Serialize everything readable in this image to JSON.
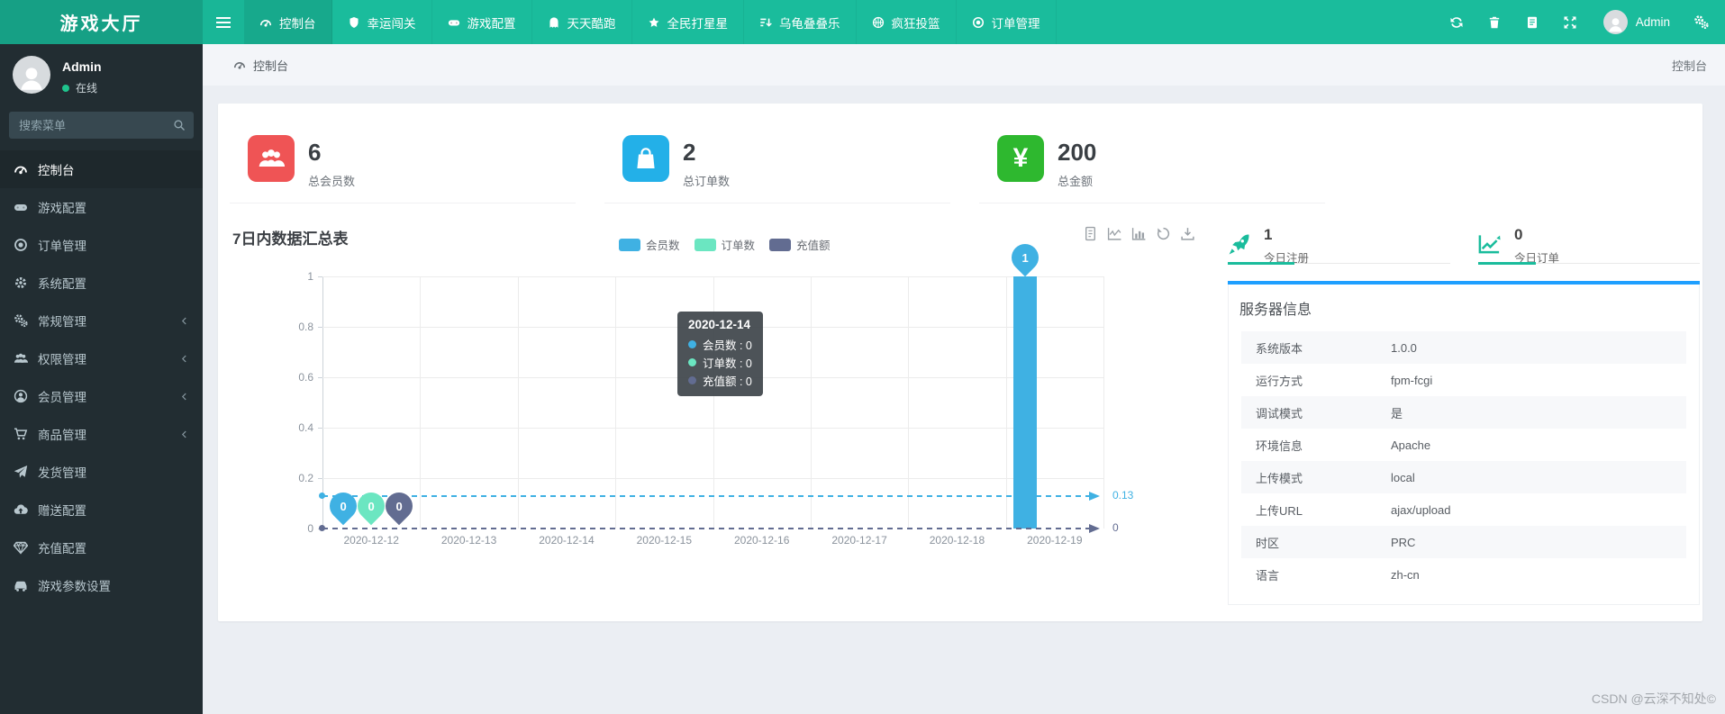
{
  "navbar": {
    "brand": "游戏大厅",
    "items": [
      {
        "label": "控制台",
        "icon": "gauge-icon",
        "active": true
      },
      {
        "label": "幸运闯关",
        "icon": "shield-icon"
      },
      {
        "label": "游戏配置",
        "icon": "gamepad-icon"
      },
      {
        "label": "天天酷跑",
        "icon": "ghost-icon"
      },
      {
        "label": "全民打星星",
        "icon": "star-icon"
      },
      {
        "label": "乌龟叠叠乐",
        "icon": "sort-icon"
      },
      {
        "label": "疯狂投篮",
        "icon": "basketball-icon"
      },
      {
        "label": "订单管理",
        "icon": "dot-circle-icon"
      }
    ],
    "right_icons": [
      "refresh-icon",
      "trash-icon",
      "log-icon",
      "expand-icon"
    ],
    "user": {
      "name": "Admin"
    }
  },
  "sidebar": {
    "user": {
      "name": "Admin",
      "status": "在线"
    },
    "search": {
      "placeholder": "搜索菜单"
    },
    "items": [
      {
        "label": "控制台",
        "icon": "gauge-icon",
        "active": true
      },
      {
        "label": "游戏配置",
        "icon": "gamepad-icon"
      },
      {
        "label": "订单管理",
        "icon": "dot-circle-icon"
      },
      {
        "label": "系统配置",
        "icon": "gear-icon"
      },
      {
        "label": "常规管理",
        "icon": "cogs-icon",
        "chevron": true
      },
      {
        "label": "权限管理",
        "icon": "users-icon",
        "chevron": true
      },
      {
        "label": "会员管理",
        "icon": "user-circle-icon",
        "chevron": true
      },
      {
        "label": "商品管理",
        "icon": "cart-icon",
        "chevron": true
      },
      {
        "label": "发货管理",
        "icon": "plane-icon"
      },
      {
        "label": "赠送配置",
        "icon": "cloud-up-icon"
      },
      {
        "label": "充值配置",
        "icon": "gem-icon"
      },
      {
        "label": "游戏参数设置",
        "icon": "car-icon"
      }
    ]
  },
  "breadcrumb": {
    "current": "控制台",
    "right": "控制台"
  },
  "stats": [
    {
      "value": "6",
      "label": "总会员数",
      "icon": "users-icon",
      "color": "#ef5455"
    },
    {
      "value": "2",
      "label": "总订单数",
      "icon": "bag-icon",
      "color": "#23b0e8"
    },
    {
      "value": "200",
      "label": "总金额",
      "icon": "yen-icon",
      "color": "#2eb82f"
    }
  ],
  "chart_data": {
    "type": "bar",
    "title": "7日内数据汇总表",
    "categories": [
      "2020-12-12",
      "2020-12-13",
      "2020-12-14",
      "2020-12-15",
      "2020-12-16",
      "2020-12-17",
      "2020-12-18",
      "2020-12-19"
    ],
    "series": [
      {
        "name": "会员数",
        "color": "#3fb1e3",
        "values": [
          0,
          0,
          0,
          0,
          0,
          0,
          0,
          1
        ]
      },
      {
        "name": "订单数",
        "color": "#6be6c1",
        "values": [
          0,
          0,
          0,
          0,
          0,
          0,
          0,
          0
        ]
      },
      {
        "name": "充值额",
        "color": "#626c91",
        "values": [
          0,
          0,
          0,
          0,
          0,
          0,
          0,
          0
        ]
      }
    ],
    "ylim": [
      0,
      1
    ],
    "yticks": [
      0,
      0.2,
      0.4,
      0.6,
      0.8,
      1
    ],
    "grid": true,
    "legend_position": "top-center",
    "marklines": [
      {
        "value": 0.13,
        "label": "0.13",
        "color": "#3fb1e3"
      },
      {
        "value": 0,
        "label": "0",
        "color": "#626c91"
      }
    ],
    "markers": [
      {
        "category_index": 0,
        "values": [
          "0",
          "0",
          "0"
        ]
      }
    ],
    "bar_pin": {
      "category_index": 7,
      "label": "1"
    },
    "tooltip": {
      "title": "2020-12-14",
      "rows": [
        {
          "name": "会员数",
          "value": "0",
          "color": "#3fb1e3"
        },
        {
          "name": "订单数",
          "value": "0",
          "color": "#6be6c1"
        },
        {
          "name": "充值额",
          "value": "0",
          "color": "#626c91"
        }
      ]
    },
    "toolbar_icons": [
      "data-view-icon",
      "line-chart-icon",
      "bar-chart-icon",
      "restore-icon",
      "download-icon"
    ]
  },
  "today_stats": [
    {
      "value": "1",
      "label": "今日注册",
      "icon": "rocket-icon"
    },
    {
      "value": "0",
      "label": "今日订单",
      "icon": "trend-icon"
    }
  ],
  "server_info": {
    "title": "服务器信息",
    "rows": [
      [
        "系统版本",
        "1.0.0"
      ],
      [
        "运行方式",
        "fpm-fcgi"
      ],
      [
        "调试模式",
        "是"
      ],
      [
        "环境信息",
        "Apache"
      ],
      [
        "上传模式",
        "local"
      ],
      [
        "上传URL",
        "ajax/upload"
      ],
      [
        "时区",
        "PRC"
      ],
      [
        "语言",
        "zh-cn"
      ]
    ]
  },
  "watermark": "CSDN @云深不知处©",
  "colors": {
    "navbar": "#1abc9c",
    "navbar_dark": "#16a085",
    "sidebar": "#222d32",
    "accent_blue_bar": "#1e9fff",
    "stat_red": "#ef5455",
    "stat_blue": "#23b0e8",
    "stat_green": "#2eb82f"
  }
}
